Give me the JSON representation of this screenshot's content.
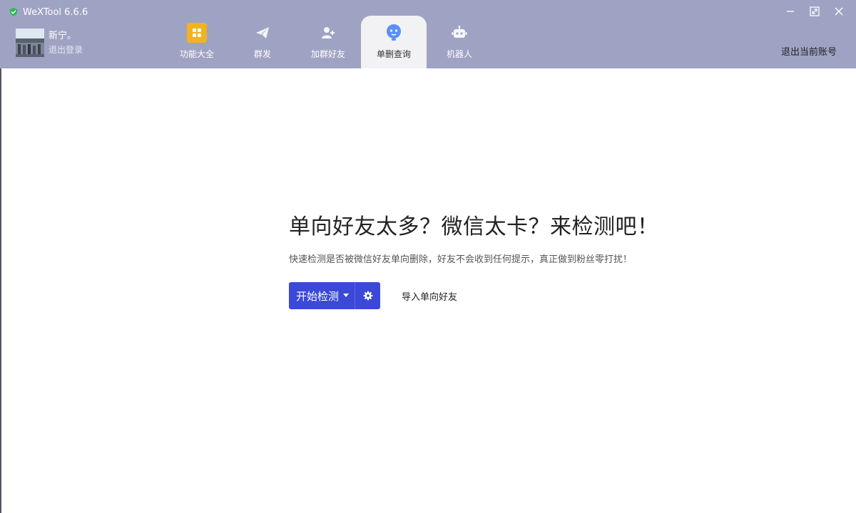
{
  "window": {
    "title": "WeXTool 6.6.6",
    "logo_icon": "green-shield-icon",
    "controls": [
      "minimize-icon",
      "maximize-icon",
      "close-icon"
    ]
  },
  "profile": {
    "username": "新宁。",
    "logout_label": "退出登录"
  },
  "nav": {
    "tabs": [
      {
        "label": "功能大全",
        "icon": "grid-icon",
        "active": false
      },
      {
        "label": "群发",
        "icon": "paper-plane-icon",
        "active": false
      },
      {
        "label": "加群好友",
        "icon": "add-friend-icon",
        "active": false
      },
      {
        "label": "单删查询",
        "icon": "face-check-icon",
        "active": true
      },
      {
        "label": "机器人",
        "icon": "robot-icon",
        "active": false
      }
    ],
    "account_exit_label": "退出当前账号"
  },
  "main": {
    "headline": "单向好友太多？微信太卡？来检测吧！",
    "subline": "快速检测是否被微信好友单向删除，好友不会收到任何提示，真正做到粉丝零打扰！",
    "start_button_label": "开始检测",
    "import_link_label": "导入单向好友"
  },
  "colors": {
    "header_bg": "#9fa3c3",
    "active_tab_bg": "#f2f2f5",
    "primary": "#3b48d8",
    "grid_icon_bg": "#f2b41c",
    "active_icon": "#5b8ff9"
  }
}
